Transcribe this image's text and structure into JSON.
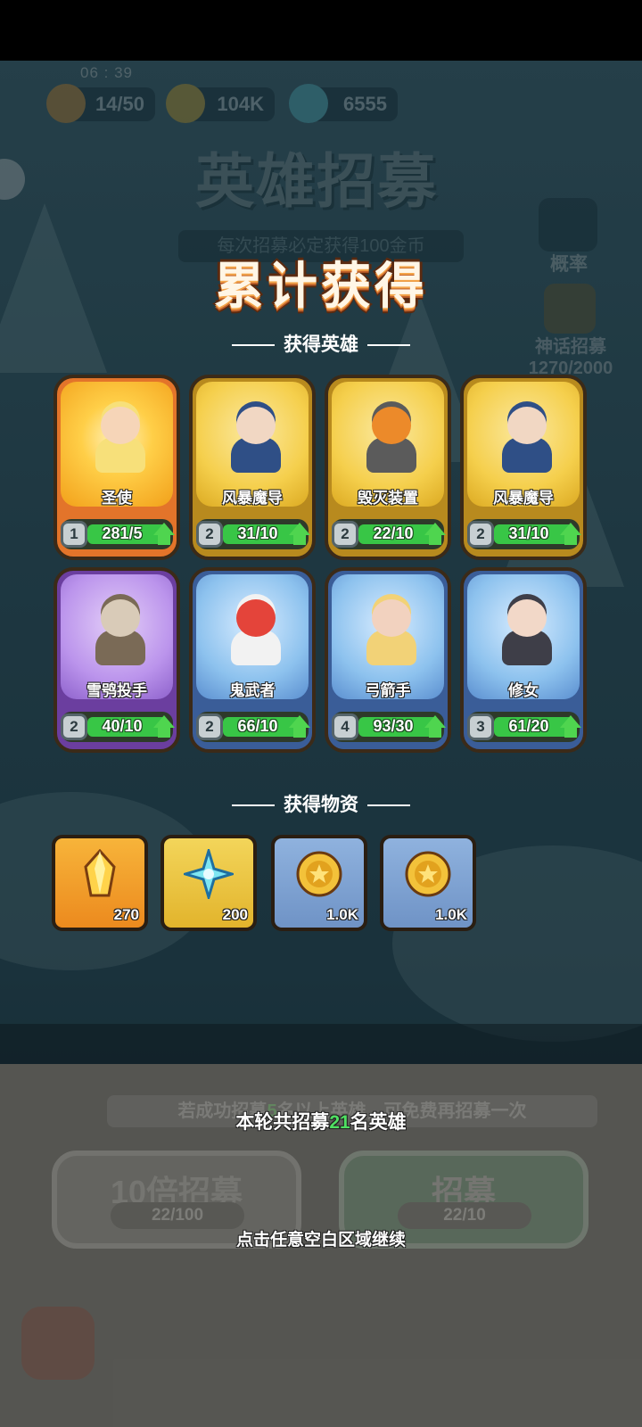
{
  "status_bar": {
    "time": "06 : 39"
  },
  "resources": [
    {
      "name": "energy",
      "icon": "flame-icon",
      "value": "14/50",
      "color": "#f2a23a"
    },
    {
      "name": "gold",
      "icon": "gold-coin-icon",
      "value": "104K",
      "color": "#f0c23a"
    },
    {
      "name": "crystal",
      "icon": "snowflake-crystal-icon",
      "value": "6555",
      "color": "#5fd6e6"
    }
  ],
  "background": {
    "title": "英雄招募",
    "subtitle": "每次招募必定获得100金币",
    "probability_label": "概率",
    "mythic_label": "神话招募",
    "mythic_progress": "1270/2000",
    "tip_prefix": "若成功招募",
    "tip_number": "5",
    "tip_suffix": "名以上英雄，可免费再招募一次",
    "ten_button": {
      "label": "10倍招募",
      "cost": "22/100"
    },
    "single_button": {
      "label": "招募",
      "cost": "22/10"
    }
  },
  "overlay": {
    "title": "累计获得",
    "heroes_heading": "获得英雄",
    "items_heading": "获得物资",
    "heroes": [
      {
        "name": "圣使",
        "level": "1",
        "count": "281/5",
        "rarity": "legend",
        "progress": 1.0,
        "skin": "#f6d5b8",
        "hair": "#f7e07a"
      },
      {
        "name": "风暴魔导",
        "level": "2",
        "count": "31/10",
        "rarity": "epic-gold",
        "progress": 1.0,
        "skin": "#f1d7c3",
        "hair": "#2f4f86"
      },
      {
        "name": "毁灭装置",
        "level": "2",
        "count": "22/10",
        "rarity": "epic-gold",
        "progress": 1.0,
        "skin": "#ec8a2a",
        "hair": "#5b5b5b"
      },
      {
        "name": "风暴魔导",
        "level": "2",
        "count": "31/10",
        "rarity": "epic-gold",
        "progress": 1.0,
        "skin": "#f1d7c3",
        "hair": "#2f4f86"
      },
      {
        "name": "雪鸮投手",
        "level": "2",
        "count": "40/10",
        "rarity": "purple",
        "progress": 1.0,
        "skin": "#d9cbb8",
        "hair": "#7a6a56"
      },
      {
        "name": "鬼武者",
        "level": "2",
        "count": "66/10",
        "rarity": "blue",
        "progress": 1.0,
        "skin": "#e4443a",
        "hair": "#f2f2f2"
      },
      {
        "name": "弓箭手",
        "level": "4",
        "count": "93/30",
        "rarity": "blue",
        "progress": 1.0,
        "skin": "#f2d2bf",
        "hair": "#f2d277"
      },
      {
        "name": "修女",
        "level": "3",
        "count": "61/20",
        "rarity": "blue",
        "progress": 1.0,
        "skin": "#f2d8c8",
        "hair": "#3e3e48"
      }
    ],
    "items": [
      {
        "name": "gold-crystal",
        "icon": "gold-crystal-icon",
        "qty": "270",
        "tile": "orange"
      },
      {
        "name": "ice-crystal",
        "icon": "snowflake-crystal-icon",
        "qty": "200",
        "tile": "gold"
      },
      {
        "name": "coin",
        "icon": "gold-coin-icon",
        "qty": "1.0K",
        "tile": "blue"
      },
      {
        "name": "coin",
        "icon": "gold-coin-icon",
        "qty": "1.0K",
        "tile": "blue"
      }
    ],
    "summary_prefix": "本轮共招募",
    "summary_number": "21",
    "summary_suffix": "名英雄",
    "continue_hint": "点击任意空白区域继续"
  }
}
